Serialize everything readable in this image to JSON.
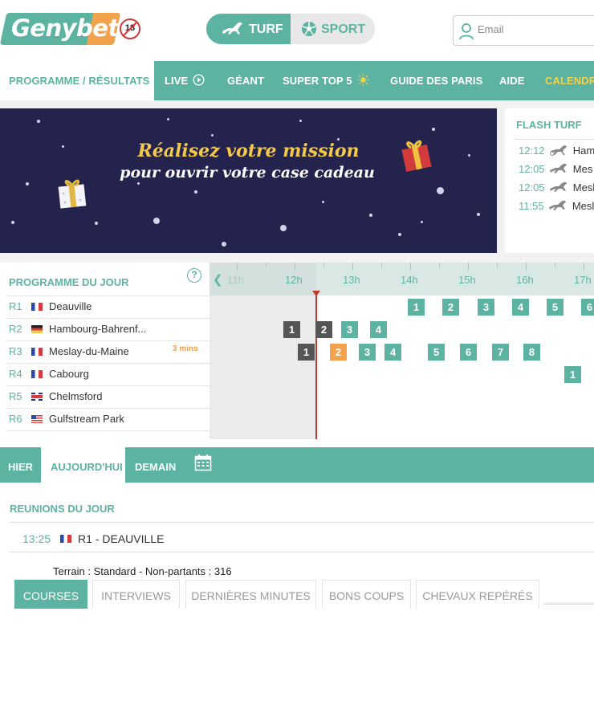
{
  "header": {
    "logo_text": "Genybet",
    "age_badge": "18",
    "switch": {
      "turf_label": "TURF",
      "sport_label": "SPORT"
    },
    "email_placeholder": "Email"
  },
  "nav": {
    "items": [
      {
        "label": "PROGRAMME / RÉSULTATS",
        "active": true
      },
      {
        "label": "LIVE"
      },
      {
        "label": "GÉANT"
      },
      {
        "label": "SUPER TOP 5"
      },
      {
        "label": "GUIDE DES PARIS"
      },
      {
        "label": "AIDE"
      },
      {
        "label": "CALENDRIER"
      }
    ]
  },
  "banner": {
    "line1": "Réalisez votre mission",
    "line2": "pour ouvrir votre case cadeau"
  },
  "flash_turf": {
    "title": "FLASH TURF",
    "entries": [
      {
        "time": "12:12",
        "name": "Ham"
      },
      {
        "time": "12:05",
        "name": "Mes"
      },
      {
        "time": "12:05",
        "name": "Mesl"
      },
      {
        "time": "11:55",
        "name": "Mesl"
      }
    ]
  },
  "programme": {
    "title": "PROGRAMME DU JOUR",
    "help": "?",
    "hours": [
      "11h",
      "12h",
      "13h",
      "14h",
      "15h",
      "16h",
      "17h"
    ],
    "countdown": "3 mins",
    "meetings": [
      {
        "code": "R1",
        "name": "Deauville",
        "country": "fr",
        "races": [
          {
            "n": "1",
            "h": 14.1,
            "s": "open"
          },
          {
            "n": "2",
            "h": 14.7,
            "s": "open"
          },
          {
            "n": "3",
            "h": 15.3,
            "s": "open"
          },
          {
            "n": "4",
            "h": 15.9,
            "s": "open"
          },
          {
            "n": "5",
            "h": 16.5,
            "s": "open"
          },
          {
            "n": "6",
            "h": 17.1,
            "s": "open"
          }
        ]
      },
      {
        "code": "R2",
        "name": "Hambourg-Bahrenf...",
        "country": "de",
        "races": [
          {
            "n": "1",
            "h": 11.95,
            "s": "done"
          },
          {
            "n": "2",
            "h": 12.5,
            "s": "done"
          },
          {
            "n": "3",
            "h": 12.95,
            "s": "open"
          },
          {
            "n": "4",
            "h": 13.45,
            "s": "open"
          }
        ]
      },
      {
        "code": "R3",
        "name": "Meslay-du-Maine",
        "country": "fr",
        "races": [
          {
            "n": "1",
            "h": 12.2,
            "s": "done"
          },
          {
            "n": "2",
            "h": 12.75,
            "s": "next"
          },
          {
            "n": "3",
            "h": 13.25,
            "s": "open"
          },
          {
            "n": "4",
            "h": 13.7,
            "s": "open"
          },
          {
            "n": "5",
            "h": 14.45,
            "s": "open"
          },
          {
            "n": "6",
            "h": 15.0,
            "s": "open"
          },
          {
            "n": "7",
            "h": 15.55,
            "s": "open"
          },
          {
            "n": "8",
            "h": 16.1,
            "s": "open"
          }
        ]
      },
      {
        "code": "R4",
        "name": "Cabourg",
        "country": "fr",
        "races": [
          {
            "n": "1",
            "h": 16.8,
            "s": "open"
          }
        ]
      },
      {
        "code": "R5",
        "name": "Chelmsford",
        "country": "gb",
        "races": []
      },
      {
        "code": "R6",
        "name": "Gulfstream Park",
        "country": "us",
        "races": []
      }
    ]
  },
  "days": {
    "yesterday": "HIER",
    "today": "AUJOURD'HUI",
    "tomorrow": "DEMAIN"
  },
  "reunions": {
    "title": "REUNIONS DU JOUR",
    "time": "13:25",
    "meeting": "R1 - DEAUVILLE",
    "terrain": "Terrain : Standard - Non-partants : 316"
  },
  "subtabs": [
    "COURSES",
    "INTERVIEWS",
    "DERNIÈRES MINUTES",
    "BONS COUPS",
    "CHEVAUX REPÉRÉS"
  ]
}
